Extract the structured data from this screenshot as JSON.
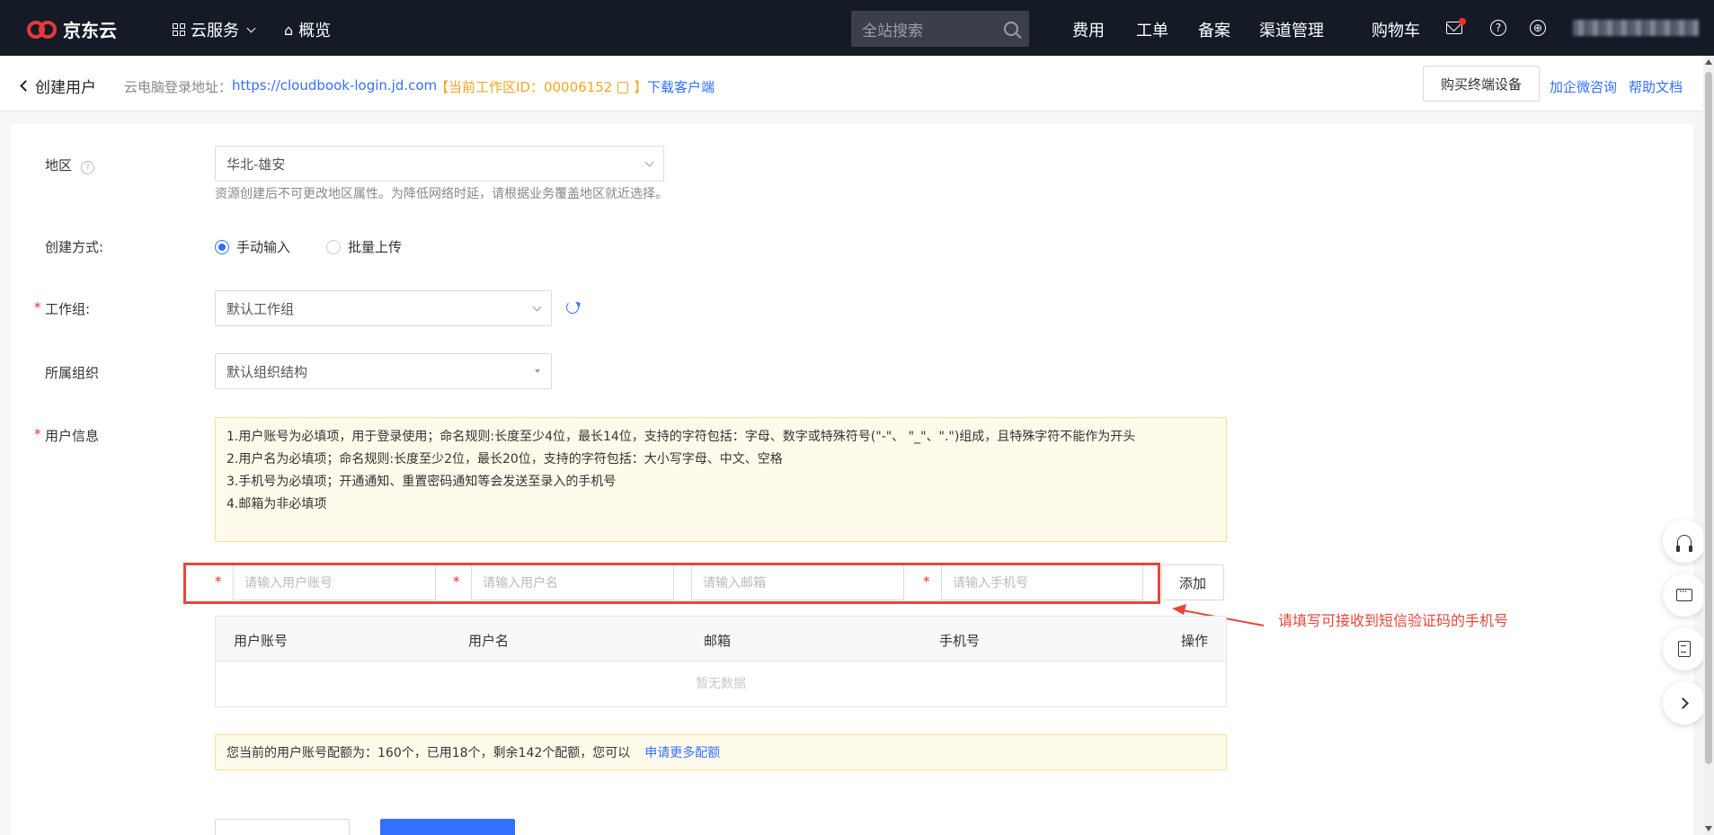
{
  "nav": {
    "brand": "京东云",
    "cloud_services": "云服务",
    "overview": "概览",
    "search_placeholder": "全站搜索",
    "links": [
      "费用",
      "工单",
      "备案",
      "渠道管理",
      "购物车"
    ]
  },
  "subheader": {
    "back_label": "创建用户",
    "login_url_label": "云电脑登录地址：",
    "login_url": "https://cloudbook-login.jd.com",
    "workspace_id": "【当前工作区ID：00006152",
    "workspace_close": "】",
    "download_client": "下载客户端",
    "buy_terminal": "购买终端设备",
    "wechat_consult": "加企微咨询",
    "help_docs": "帮助文档"
  },
  "form": {
    "region_label": "地区",
    "region_value": "华北-雄安",
    "region_hint": "资源创建后不可更改地区属性。为降低网络时延，请根据业务覆盖地区就近选择。",
    "create_method_label": "创建方式:",
    "method_manual": "手动输入",
    "method_batch": "批量上传",
    "workgroup_label": "工作组:",
    "workgroup_value": "默认工作组",
    "org_label": "所属组织",
    "org_value": "默认组织结构",
    "userinfo_label": "用户信息",
    "notice_lines": [
      "1.用户账号为必填项，用于登录使用；命名规则:长度至少4位，最长14位，支持的字符包括：字母、数字或特殊符号(\"-\"、 \"_\"、\".\")组成，且特殊字符不能作为开头",
      "2.用户名为必填项；命名规则:长度至少2位，最长20位，支持的字符包括：大小写字母、中文、空格",
      "3.手机号为必填项；开通通知、重置密码通知等会发送至录入的手机号",
      "4.邮箱为非必填项"
    ],
    "placeholders": {
      "account": "请输入用户账号",
      "username": "请输入用户名",
      "email": "请输入邮箱",
      "phone": "请输入手机号"
    },
    "add_button": "添加",
    "annotation": "请填写可接收到短信验证码的手机号",
    "table_headers": [
      "用户账号",
      "用户名",
      "邮箱",
      "手机号",
      "操作"
    ],
    "table_empty": "暂无数据",
    "quota_text": "您当前的用户账号配额为：160个，已用18个，剩余142个配额，您可以",
    "quota_link": "申请更多配额"
  },
  "colors": {
    "nav_bg": "#141a26",
    "accent": "#3370ff",
    "warning_border": "#fbe08d",
    "annotation": "#e8463a"
  }
}
